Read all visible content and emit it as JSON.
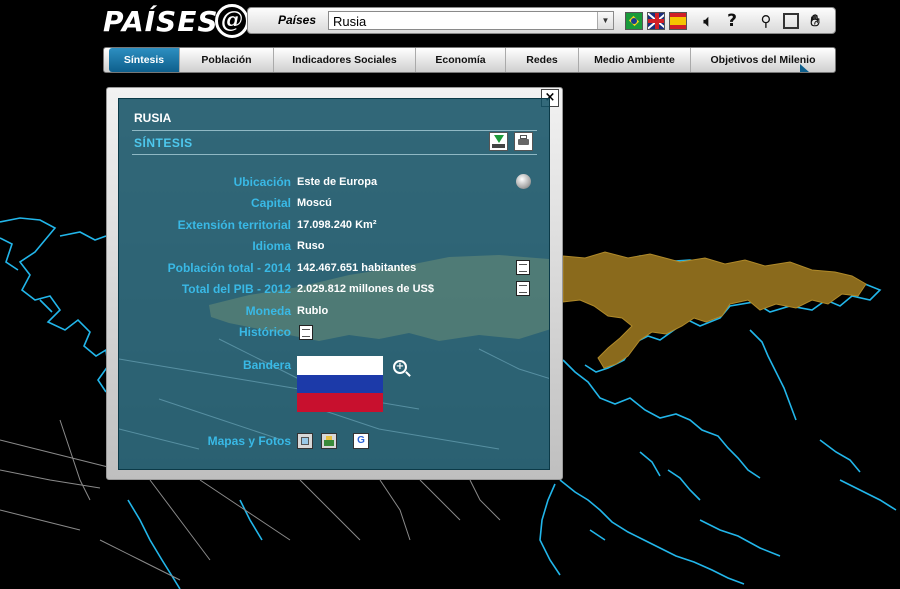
{
  "app": {
    "logo_text": "PAÍSES",
    "logo_mark": "@"
  },
  "header": {
    "country_label": "Países",
    "country_selected": "Rusia",
    "languages": [
      {
        "name": "brazil-flag-icon",
        "color": "#199a3a"
      },
      {
        "name": "uk-flag-icon",
        "color": "#1b2f7d"
      },
      {
        "name": "spain-flag-icon",
        "color": "#d11f26"
      }
    ],
    "tools": [
      "speaker-icon",
      "help-icon",
      "search-icon",
      "zoom-icon",
      "hand-icon"
    ],
    "help_glyph": "?"
  },
  "tabs": [
    {
      "label": "Síntesis",
      "active": true
    },
    {
      "label": "Población"
    },
    {
      "label": "Indicadores Sociales"
    },
    {
      "label": "Economía"
    },
    {
      "label": "Redes"
    },
    {
      "label": "Medio Ambiente"
    },
    {
      "label": "Objetivos del Milenio"
    }
  ],
  "panel": {
    "close_glyph": "×",
    "country": "RUSIA",
    "section": "SÍNTESIS",
    "rows": [
      {
        "label": "Ubicación",
        "value": "Este de Europa"
      },
      {
        "label": "Capital",
        "value": "Moscú"
      },
      {
        "label": "Extensión territorial",
        "value": "17.098.240 Km²"
      },
      {
        "label": "Idioma",
        "value": "Ruso"
      },
      {
        "label": "Población total - 2014",
        "value": "142.467.651 habitantes"
      },
      {
        "label": "Total del PIB - 2012",
        "value": "2.029.812 millones de US$"
      },
      {
        "label": "Moneda",
        "value": "Rublo"
      },
      {
        "label": "Histórico",
        "value": ""
      },
      {
        "label": "Bandera",
        "value": ""
      },
      {
        "label": "Mapas y Fotos",
        "value": ""
      }
    ],
    "flag_colors": [
      "#ffffff",
      "#1c3aa9",
      "#c8102e"
    ],
    "map_links": [
      "map-icon",
      "photo-icon",
      "google-icon"
    ],
    "google_glyph": "G"
  },
  "colors": {
    "accent": "#39b9e6",
    "panel_bg": "#125064",
    "russia_fill": "#8a6a1c",
    "coast": "#1fb4e6"
  }
}
